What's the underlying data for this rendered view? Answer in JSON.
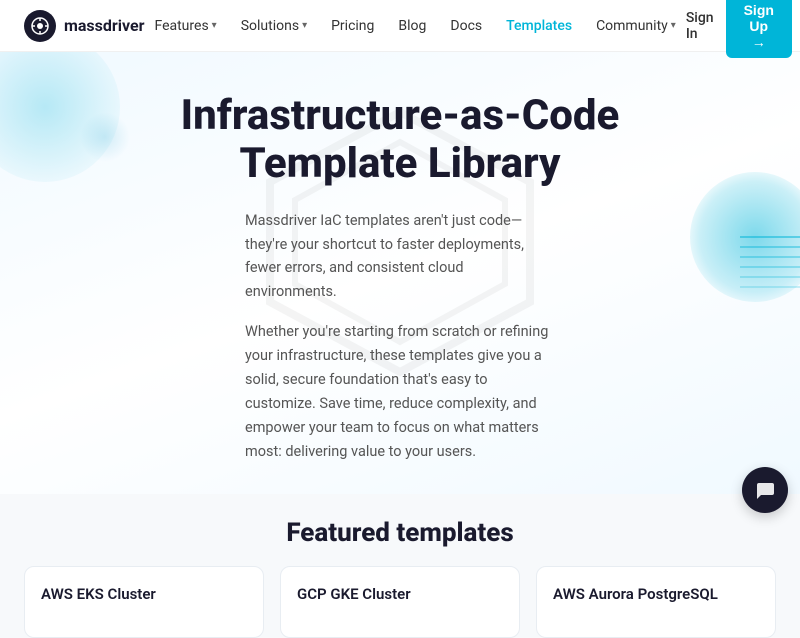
{
  "brand": {
    "name": "massdriver",
    "logo_alt": "massdriver logo"
  },
  "nav": {
    "links": [
      {
        "label": "Features",
        "has_dropdown": true,
        "active": false
      },
      {
        "label": "Solutions",
        "has_dropdown": true,
        "active": false
      },
      {
        "label": "Pricing",
        "has_dropdown": false,
        "active": false
      },
      {
        "label": "Blog",
        "has_dropdown": false,
        "active": false
      },
      {
        "label": "Docs",
        "has_dropdown": false,
        "active": false
      },
      {
        "label": "Templates",
        "has_dropdown": false,
        "active": true
      },
      {
        "label": "Community",
        "has_dropdown": true,
        "active": false
      }
    ],
    "signin_label": "Sign In",
    "signup_label": "Sign Up →"
  },
  "hero": {
    "title": "Infrastructure-as-Code Template Library",
    "desc1": "Massdriver IaC templates aren't just code—they're your shortcut to faster deployments, fewer errors, and consistent cloud environments.",
    "desc2": "Whether you're starting from scratch or refining your infrastructure, these templates give you a solid, secure foundation that's easy to customize. Save time, reduce complexity, and empower your team to focus on what matters most: delivering value to your users."
  },
  "featured": {
    "title": "Featured templates",
    "cards": [
      {
        "label": "AWS EKS Cluster"
      },
      {
        "label": "GCP GKE Cluster"
      },
      {
        "label": "AWS Aurora PostgreSQL"
      }
    ]
  },
  "chat": {
    "icon": "💬"
  }
}
